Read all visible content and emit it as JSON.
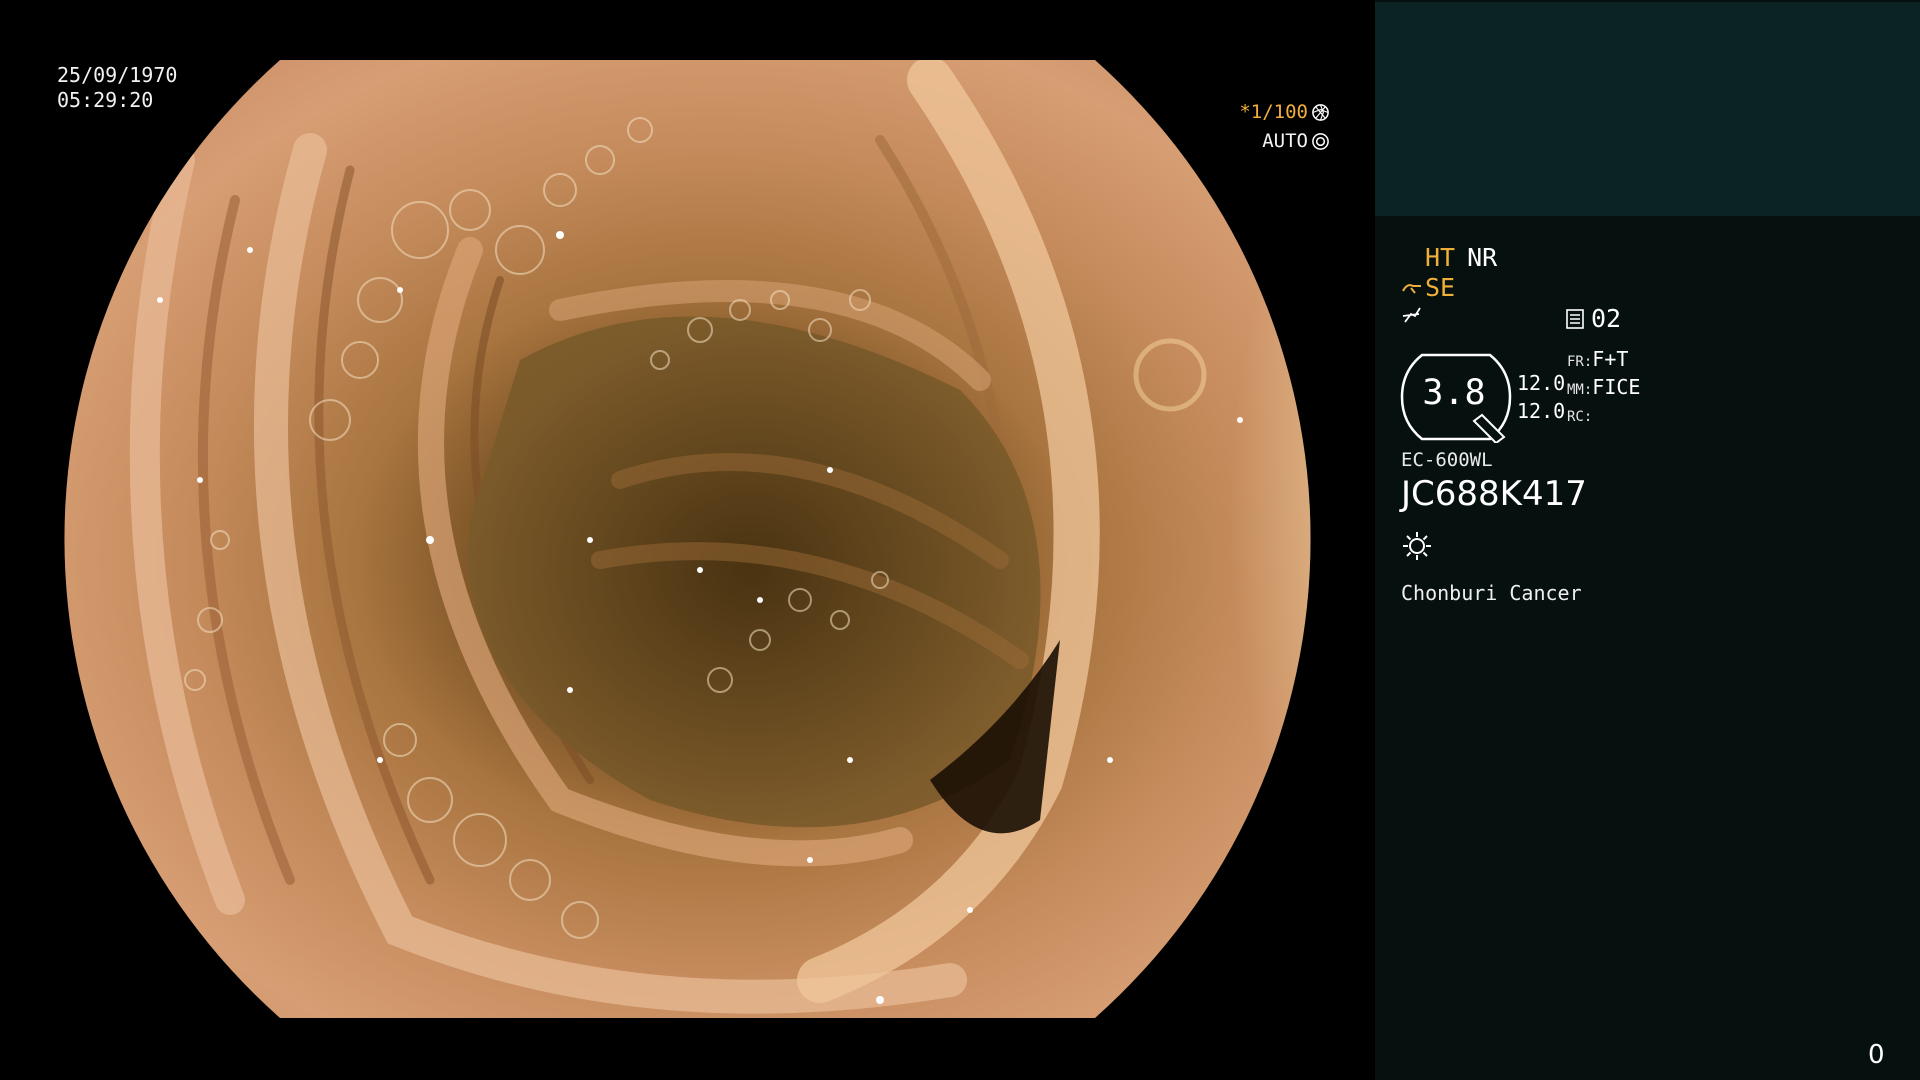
{
  "overlay": {
    "date": "25/09/1970",
    "time": "05:29:20",
    "shutter": "*1/100",
    "exposure": "AUTO",
    "icons": [
      "aperture-icon",
      "iris-icon"
    ]
  },
  "panel": {
    "ht_label": "HT",
    "nr_label": "NR",
    "se_label": "SE",
    "mode_value": "02",
    "gauge_value": "3.8",
    "gauge_num_1": "12.0",
    "gauge_num_2": "12.0",
    "fr_label": "FR:",
    "fr_value": "F+T",
    "mm_label": "MM:",
    "mm_value": "FICE",
    "rc_label": "RC:",
    "scope_model": "EC-600WL",
    "serial": "JC688K417",
    "facility": "Chonburi Cancer",
    "frame_count": "0",
    "icons": [
      "scope-icon",
      "flash-off-icon",
      "memory-icon",
      "light-source-icon"
    ]
  },
  "colors": {
    "accent": "#f0ae3b",
    "panel_bg": "#06110f",
    "panel_header_bg": "#0b2322"
  }
}
